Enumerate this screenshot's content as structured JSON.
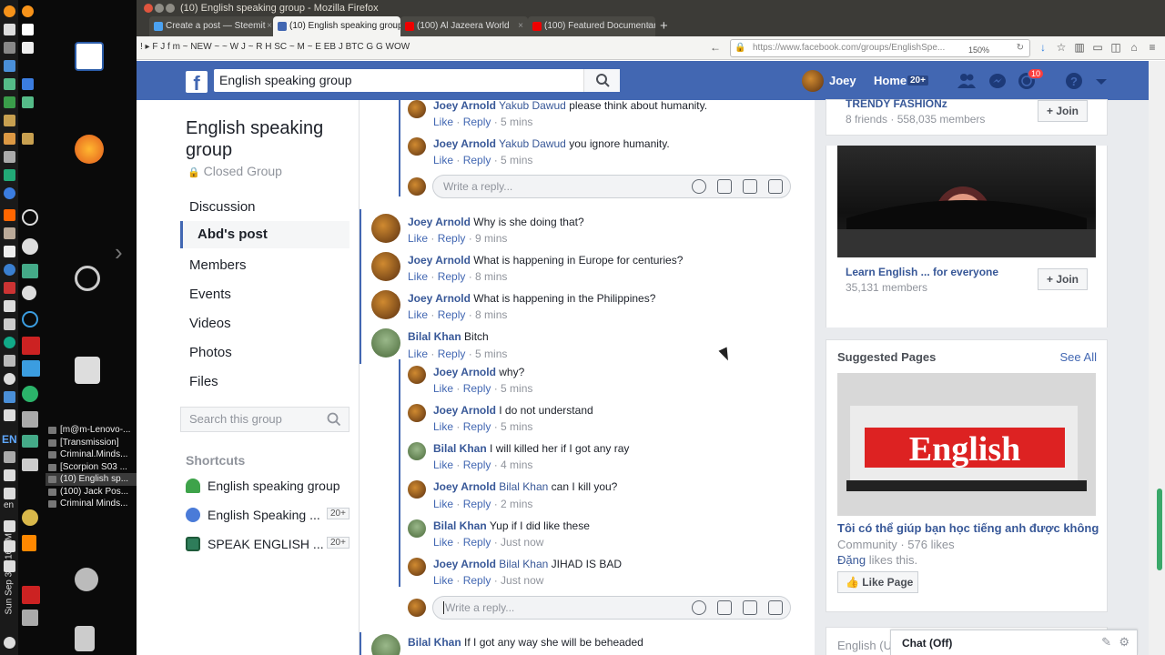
{
  "window": {
    "title": "(10) English speaking group - Mozilla Firefox"
  },
  "tabs": [
    {
      "label": "Create a post — Steemit"
    },
    {
      "label": "(10) English speaking group"
    },
    {
      "label": "(100) Al Jazeera World"
    },
    {
      "label": "(100) Featured Documentaries"
    }
  ],
  "bookmarks": "! ▸ F J f m ~ NEW ~ ~ W J ~ R H SC ~ M ~ E EB J BTC G G WOW",
  "url": {
    "value": "https://www.facebook.com/groups/EnglishSpe...",
    "zoom": "150%"
  },
  "fb": {
    "search": "English speaking group",
    "user": "Joey",
    "home": "Home",
    "home_badge": "20+",
    "notif_badge": "10"
  },
  "group": {
    "name": "English speaking group",
    "type": "Closed Group",
    "nav": [
      "Discussion",
      "Abd's post",
      "Members",
      "Events",
      "Videos",
      "Photos",
      "Files"
    ],
    "search_placeholder": "Search this group",
    "shortcuts_title": "Shortcuts",
    "shortcuts": [
      {
        "label": "English speaking group",
        "badge": ""
      },
      {
        "label": "English Speaking ...",
        "badge": "20+"
      },
      {
        "label": "SPEAK ENGLISH ...",
        "badge": "20+"
      }
    ]
  },
  "comments": [
    {
      "name": "Joey Arnold",
      "tag": "Yakub Dawud",
      "text": "please think about humanity.",
      "like": "Like",
      "reply": "Reply",
      "time": "5 mins"
    },
    {
      "name": "Joey Arnold",
      "tag": "Yakub Dawud",
      "text": "you ignore humanity.",
      "like": "Like",
      "reply": "Reply",
      "time": "5 mins"
    },
    {
      "name": "Joey Arnold",
      "tag": "",
      "text": "Why is she doing that?",
      "like": "Like",
      "reply": "Reply",
      "time": "9 mins"
    },
    {
      "name": "Joey Arnold",
      "tag": "",
      "text": "What is happening in Europe for centuries?",
      "like": "Like",
      "reply": "Reply",
      "time": "8 mins"
    },
    {
      "name": "Joey Arnold",
      "tag": "",
      "text": "What is happening in the Philippines?",
      "like": "Like",
      "reply": "Reply",
      "time": "8 mins"
    },
    {
      "name": "Bilal Khan",
      "tag": "",
      "text": "Bitch",
      "like": "Like",
      "reply": "Reply",
      "time": "5 mins"
    },
    {
      "name": "Joey Arnold",
      "tag": "",
      "text": "why?",
      "like": "Like",
      "reply": "Reply",
      "time": "5 mins"
    },
    {
      "name": "Joey Arnold",
      "tag": "",
      "text": "I do not understand",
      "like": "Like",
      "reply": "Reply",
      "time": "5 mins"
    },
    {
      "name": "Bilal Khan",
      "tag": "",
      "text": "I will killed her if I got any ray",
      "like": "Like",
      "reply": "Reply",
      "time": "4 mins"
    },
    {
      "name": "Joey Arnold",
      "tag": "Bilal Khan",
      "text": "can I kill you?",
      "like": "Like",
      "reply": "Reply",
      "time": "2 mins"
    },
    {
      "name": "Bilal Khan",
      "tag": "",
      "text": "Yup if I did like these",
      "like": "Like",
      "reply": "Reply",
      "time": "Just now"
    },
    {
      "name": "Joey Arnold",
      "tag": "Bilal Khan",
      "text": "JIHAD IS BAD",
      "like": "Like",
      "reply": "Reply",
      "time": "Just now"
    },
    {
      "name": "Bilal Khan",
      "tag": "",
      "text": "If I got any way she will be beheaded"
    }
  ],
  "reply_placeholder": "Write a reply...",
  "right": {
    "group1": {
      "name": "TRENDY FASHIONz",
      "meta": "8 friends · 558,035 members",
      "join": "Join"
    },
    "group2": {
      "name": "Learn English ... for everyone",
      "meta": "35,131 members",
      "join": "Join"
    },
    "suggested_title": "Suggested Pages",
    "see_all": "See All",
    "page_name": "Tôi có thể giúp bạn học tiếng anh được không",
    "page_meta": "Community · 576 likes",
    "liker": "Đặng",
    "liker_suffix": "likes this.",
    "like_page": "Like Page",
    "lang_partial": "English (U"
  },
  "chat": {
    "label": "Chat (Off)"
  },
  "desktop": {
    "windows": [
      "[m@m-Lenovo-...",
      "[Transmission]",
      "Criminal.Minds...",
      "[Scorpion S03 ...",
      "(10) English sp...",
      "(100) Jack Pos...",
      "Criminal Minds..."
    ],
    "lang": "EN",
    "lang2": "en",
    "clock": "Sun Sep 3, 7:16 PM"
  }
}
